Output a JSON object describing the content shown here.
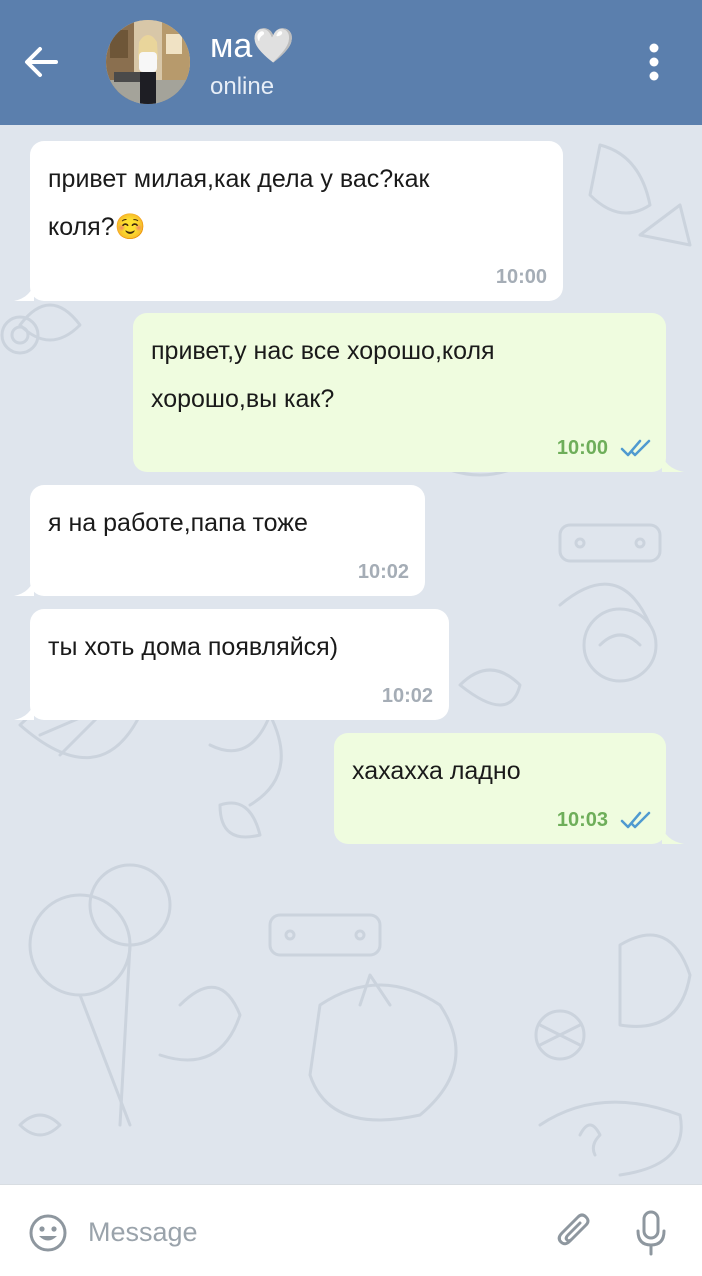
{
  "header": {
    "back_icon": "arrow-left-icon",
    "contact_name": "ма🤍",
    "status": "online",
    "menu_icon": "more-vertical-icon",
    "background_color": "#5b7fad"
  },
  "messages": [
    {
      "direction": "incoming",
      "lines": [
        "привет милая,как дела у вас?как",
        "коля?☺️"
      ],
      "time": "10:00"
    },
    {
      "direction": "outgoing",
      "lines": [
        "привет,у нас все хорошо,коля",
        "хорошо,вы как?"
      ],
      "time": "10:00",
      "status_icon": "double-check-icon"
    },
    {
      "direction": "incoming",
      "lines": [
        "я на работе,папа тоже"
      ],
      "time": "10:02"
    },
    {
      "direction": "incoming",
      "lines": [
        "ты хоть дома появляйся)"
      ],
      "time": "10:02"
    },
    {
      "direction": "outgoing",
      "lines": [
        "хахахха ладно"
      ],
      "time": "10:03",
      "status_icon": "double-check-icon"
    }
  ],
  "input_bar": {
    "emoji_icon": "smiley-icon",
    "placeholder": "Message",
    "attach_icon": "paperclip-icon",
    "mic_icon": "microphone-icon"
  },
  "colors": {
    "incoming_bubble": "#ffffff",
    "outgoing_bubble": "#effcdf",
    "outgoing_time": "#6eae5a",
    "incoming_time": "#a5adb6",
    "read_ticks": "#4f9ad0"
  }
}
